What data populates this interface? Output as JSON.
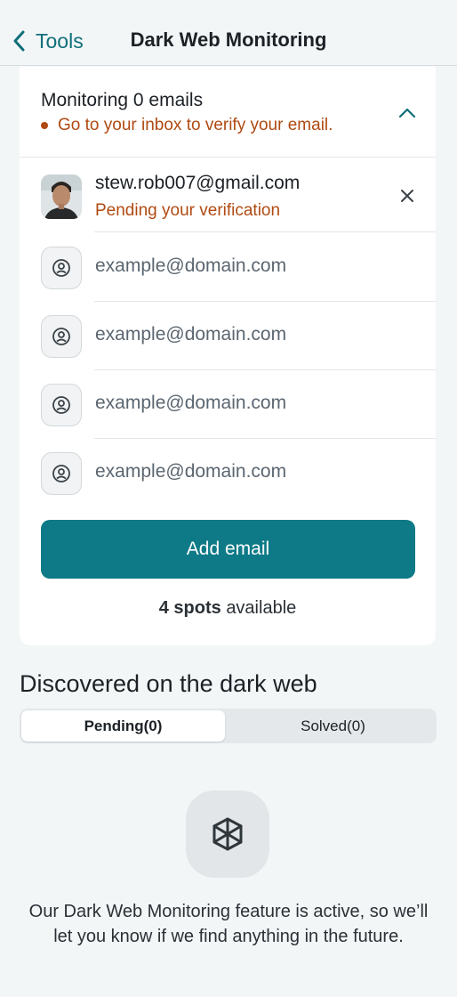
{
  "nav": {
    "back_label": "Tools",
    "title": "Dark Web Monitoring",
    "back_icon": "chevron-left-icon"
  },
  "monitoring": {
    "title": "Monitoring 0 emails",
    "warning": "Go to your inbox to verify your email.",
    "collapse_icon": "chevron-up-icon",
    "accent_color": "#0e7a87",
    "warning_color": "#b04a12"
  },
  "emails": [
    {
      "address": "stew.rob007@gmail.com",
      "status": "Pending your verification",
      "remove_icon": "close-icon"
    }
  ],
  "slots": [
    {
      "placeholder": "example@domain.com",
      "icon": "user-circle-icon"
    },
    {
      "placeholder": "example@domain.com",
      "icon": "user-circle-icon"
    },
    {
      "placeholder": "example@domain.com",
      "icon": "user-circle-icon"
    },
    {
      "placeholder": "example@domain.com",
      "icon": "user-circle-icon"
    }
  ],
  "add_button": {
    "label": "Add email"
  },
  "spots": {
    "count": "4 spots",
    "suffix": "available"
  },
  "discovered": {
    "title": "Discovered on the dark web",
    "tabs": [
      {
        "label": "Pending(0)",
        "selected": true
      },
      {
        "label": "Solved(0)",
        "selected": false
      }
    ],
    "empty_icon": "dark-web-cube-icon",
    "empty_message": "Our Dark Web Monitoring feature is active, so we’ll let you know if we find anything in the future."
  }
}
